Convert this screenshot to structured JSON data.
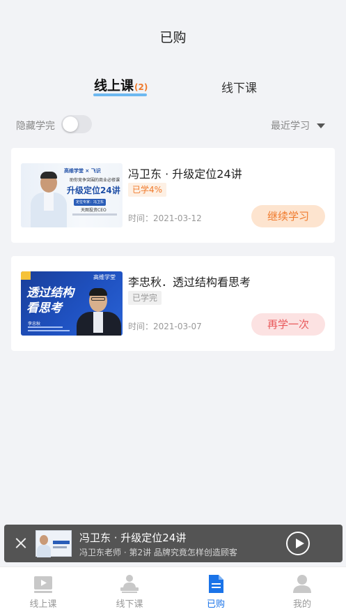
{
  "header": {
    "title": "已购"
  },
  "tabs": [
    {
      "label": "线上课",
      "count": "(2)",
      "active": true
    },
    {
      "label": "线下课",
      "active": false
    }
  ],
  "filter": {
    "hide_finished_label": "隐藏学完",
    "hide_finished_on": false,
    "sort_label": "最近学习"
  },
  "courses": [
    {
      "title": "冯卫东 · 升级定位24讲",
      "badge": "已学4%",
      "time": "时间：2021-03-12",
      "action": "继续学习",
      "thumb": {
        "brand": "高维学堂 × 飞识",
        "subtitle": "助你竞争突围的商业必修课",
        "main": "升级定位24讲",
        "tag": "定位专家：冯卫东",
        "role": "天图投资CEO"
      }
    },
    {
      "title": "李忠秋．透过结构看思考",
      "badge": "已学完",
      "time": "时间：2021-03-07",
      "action": "再学一次",
      "thumb": {
        "line1": "透过结构",
        "line2": "看思考",
        "brand": "高维学堂",
        "name": "李忠秋"
      }
    }
  ],
  "player": {
    "title": "冯卫东 · 升级定位24讲",
    "subtitle": "冯卫东老师 · 第2讲 品牌究竟怎样创造顾客"
  },
  "nav": [
    {
      "label": "线上课",
      "icon": "video-icon",
      "active": false
    },
    {
      "label": "线下课",
      "icon": "classroom-icon",
      "active": false
    },
    {
      "label": "已购",
      "icon": "document-icon",
      "active": true
    },
    {
      "label": "我的",
      "icon": "person-icon",
      "active": false
    }
  ],
  "colors": {
    "accent": "#1a73e8",
    "orange": "#f07a2c",
    "red": "#e8585a",
    "tab_underline": "#6eb8f0"
  }
}
